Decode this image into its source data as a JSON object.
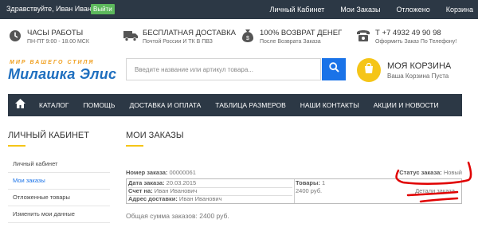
{
  "topbar": {
    "greeting": "Здравствуйте, Иван Иванович !",
    "login_label": "Выйти",
    "links": [
      "Личный Кабинет",
      "Мои Заказы",
      "Отложено",
      "Корзина"
    ]
  },
  "info": [
    {
      "icon": "clock-icon",
      "title": "Часы работы",
      "subtitle": "ПН-ПТ 9:00 - 18.00 МСК"
    },
    {
      "icon": "truck-icon",
      "title": "Бесплатная доставка",
      "subtitle": "Почтой России И ТК В ПВЗ"
    },
    {
      "icon": "money-bag-icon",
      "title": "100% возврат денег",
      "subtitle": "После Возврата Заказа"
    },
    {
      "icon": "phone-icon",
      "title": "Т +7 4932 49 90 98",
      "subtitle": "Оформить Заказ По Телефону!"
    }
  ],
  "logo": {
    "sub": "МИР ВАШЕГО СТИЛЯ",
    "main": "Милашка Элис"
  },
  "search": {
    "placeholder": "Введите название или артикул товара..."
  },
  "cart": {
    "title": "Моя корзина",
    "subtitle": "Ваша Корзина Пуста"
  },
  "nav": {
    "items": [
      "Каталог",
      "Помощь",
      "Доставка и оплата",
      "Таблица размеров",
      "Наши контакты",
      "Акции и новости"
    ]
  },
  "sidebar": {
    "title": "Личный кабинет",
    "items": [
      "Личный кабинет",
      "Мои заказы",
      "Отложенные товары",
      "Изменить мои данные"
    ]
  },
  "main": {
    "title": "Мои заказы",
    "order": {
      "number_label": "Номер заказа:",
      "number": "00000061",
      "status_label": "Статус заказа:",
      "status": "Новый",
      "date_label": "Дата заказа:",
      "date": "20.03.2015",
      "invoice_label": "Счет на:",
      "invoice": "Иван Иванович",
      "address_label": "Адрес доставки:",
      "address": "Иван Иванович",
      "items_label": "Товары:",
      "items_count": "1",
      "price": "2400 руб.",
      "details_label": "Детали заказа"
    },
    "total": "Общая сумма заказов: 2400 руб."
  },
  "colors": {
    "dark_bar": "#2c3845",
    "accent_yellow": "#f5c518",
    "accent_blue": "#1a73e8",
    "annotation_red": "#e00000"
  }
}
